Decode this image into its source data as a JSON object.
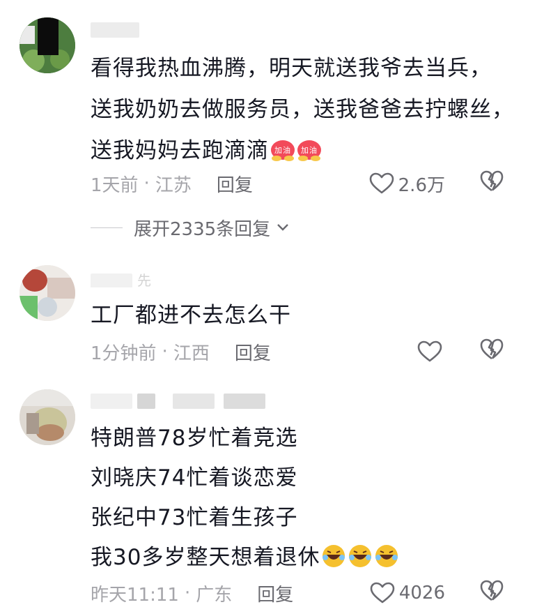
{
  "comments": [
    {
      "text": "看得我热血沸腾，明天就送我爷去当兵，\n送我奶奶去做服务员，送我爸爸去拧螺丝，\n送我妈妈去跑滴滴",
      "emoji_label": "加油",
      "time": "1天前",
      "location": "江苏",
      "reply_label": "回复",
      "likes": "2.6万"
    },
    {
      "username_fragment": "先",
      "text": "工厂都进不去怎么干",
      "time": "1分钟前",
      "location": "江西",
      "reply_label": "回复"
    },
    {
      "text": "特朗普78岁忙着竞选\n刘晓庆74忙着谈恋爱\n张纪中73忙着生孩子\n我30多岁整天想着退休",
      "time": "昨天11:11",
      "location": "广东",
      "reply_label": "回复",
      "likes": "4026"
    }
  ],
  "expand": {
    "label": "展开2335条回复"
  },
  "meta_separator": "·",
  "colors": {
    "text": "#161823",
    "meta": "#a5a5aa",
    "action": "#6a6a70"
  }
}
